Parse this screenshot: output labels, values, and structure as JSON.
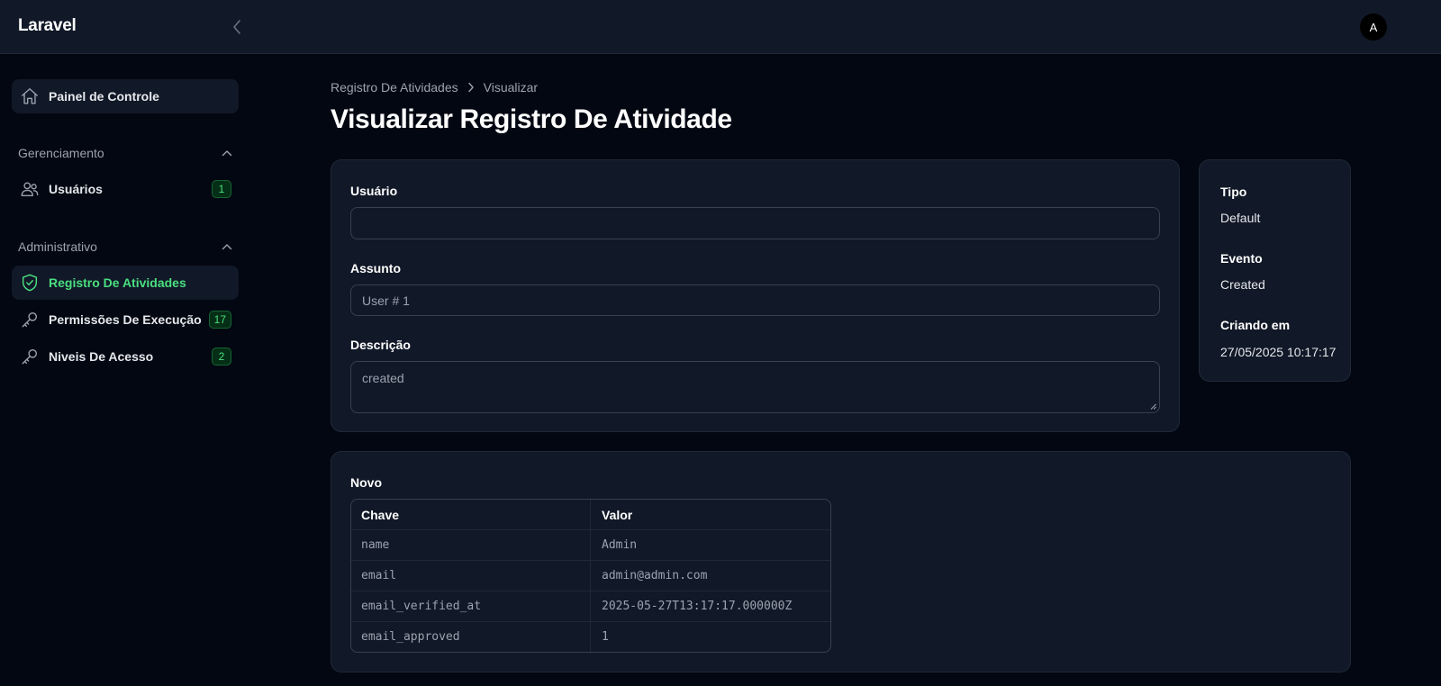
{
  "app": {
    "brand": "Laravel",
    "avatar_initial": "A"
  },
  "sidebar": {
    "dashboard": {
      "label": "Painel de Controle",
      "icon": "home-icon"
    },
    "groups": [
      {
        "label": "Gerenciamento",
        "items": [
          {
            "label": "Usuários",
            "icon": "users-icon",
            "badge": "1"
          }
        ]
      },
      {
        "label": "Administrativo",
        "items": [
          {
            "label": "Registro De Atividades",
            "icon": "shield-check-icon",
            "active": true
          },
          {
            "label": "Permissões De Execução",
            "icon": "key-icon",
            "badge": "17"
          },
          {
            "label": "Niveis De Acesso",
            "icon": "key-icon",
            "badge": "2"
          }
        ]
      }
    ]
  },
  "breadcrumb": {
    "items": [
      "Registro De Atividades",
      "Visualizar"
    ]
  },
  "page": {
    "title": "Visualizar Registro De Atividade"
  },
  "form": {
    "usuario": {
      "label": "Usuário",
      "value": ""
    },
    "assunto": {
      "label": "Assunto",
      "value": "User # 1"
    },
    "descricao": {
      "label": "Descrição",
      "value": "created"
    }
  },
  "meta": {
    "tipo": {
      "label": "Tipo",
      "value": "Default"
    },
    "evento": {
      "label": "Evento",
      "value": "Created"
    },
    "criado": {
      "label": "Criando em",
      "value": "27/05/2025 10:17:17"
    }
  },
  "novo": {
    "title": "Novo",
    "headers": {
      "key": "Chave",
      "value": "Valor"
    },
    "rows": [
      {
        "key": "name",
        "value": "Admin"
      },
      {
        "key": "email",
        "value": "admin@admin.com"
      },
      {
        "key": "email_verified_at",
        "value": "2025-05-27T13:17:17.000000Z"
      },
      {
        "key": "email_approved",
        "value": "1"
      }
    ]
  },
  "colors": {
    "background": "#030712",
    "surface": "#111827",
    "accent": "#4ade80",
    "badge_bg": "#052e16"
  }
}
